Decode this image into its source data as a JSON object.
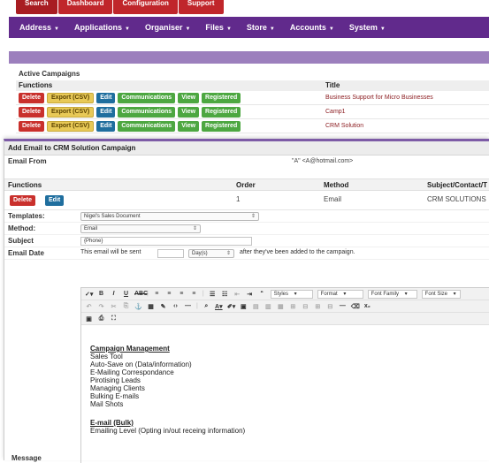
{
  "top_tabs": [
    "Search",
    "Dashboard",
    "Configuration",
    "Support"
  ],
  "nav": [
    "Address",
    "Applications",
    "Organiser",
    "Files",
    "Store",
    "Accounts",
    "System"
  ],
  "background_panel": {
    "heading": "Active Campaigns",
    "col_functions": "Functions",
    "col_title": "Title",
    "rows": [
      {
        "title": "Business Support for Micro Businesses"
      },
      {
        "title": "Camp1"
      },
      {
        "title": "CRM Solution"
      }
    ],
    "buttons": {
      "delete": "Delete",
      "export": "Export (CSV)",
      "edit": "Edit",
      "communications": "Communications",
      "view": "View",
      "registered": "Registered"
    }
  },
  "form": {
    "title": "Add Email to CRM Solution Campaign",
    "email_from_label": "Email From",
    "email_from_value": "\"A\" <A@hotmail.com>",
    "functions_label": "Functions",
    "order_label": "Order",
    "method_label": "Method",
    "subject_contact_label": "Subject/Contact/T",
    "row": {
      "order": "1",
      "method": "Email",
      "subject": "CRM SOLUTIONS",
      "delete": "Delete",
      "edit": "Edit"
    },
    "templates_label": "Templates:",
    "templates_value": "Nigel's Sales Document",
    "method_field_label": "Method:",
    "method_value": "Email",
    "subject_label": "Subject",
    "subject_value": "{Phone}",
    "email_date_label": "Email Date",
    "email_date_prefix": "This email will be sent",
    "email_date_unit": "Day(s)",
    "email_date_suffix": "after they've been added to the campaign.",
    "message_label": "Message"
  },
  "toolbar": {
    "styles": "Styles",
    "format": "Format",
    "font_family": "Font Family",
    "font_size": "Font Size"
  },
  "editor": {
    "section1_heading": "Campaign Management",
    "section1_items": [
      "Sales Tool",
      "Auto-Save on (Data/information)",
      "E-Mailing Correspondance",
      "Pirotising Leads",
      "Managing Clients",
      "Bulking E-mails",
      "Mail Shots"
    ],
    "section2_heading": "E-mail (Bulk)",
    "section2_items": [
      "Emailing Level (Opting in/out receing information)"
    ]
  }
}
